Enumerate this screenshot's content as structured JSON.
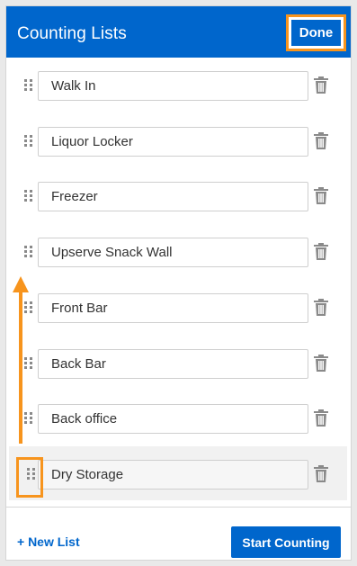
{
  "header": {
    "title": "Counting Lists",
    "done_label": "Done"
  },
  "lists": [
    {
      "name": "Walk In"
    },
    {
      "name": "Liquor Locker"
    },
    {
      "name": "Freezer"
    },
    {
      "name": "Upserve Snack Wall"
    },
    {
      "name": "Front Bar"
    },
    {
      "name": "Back Bar"
    },
    {
      "name": "Back office"
    },
    {
      "name": "Dry Storage",
      "selected": true
    }
  ],
  "footer": {
    "new_list_label": "+ New List",
    "start_label": "Start Counting"
  },
  "colors": {
    "brand": "#0066cc",
    "highlight": "#f7941d",
    "icon": "#8a8a8a"
  },
  "icons": {
    "handle": "drag-handle-icon",
    "delete": "trash-icon",
    "annotation": "arrow-up-icon"
  }
}
